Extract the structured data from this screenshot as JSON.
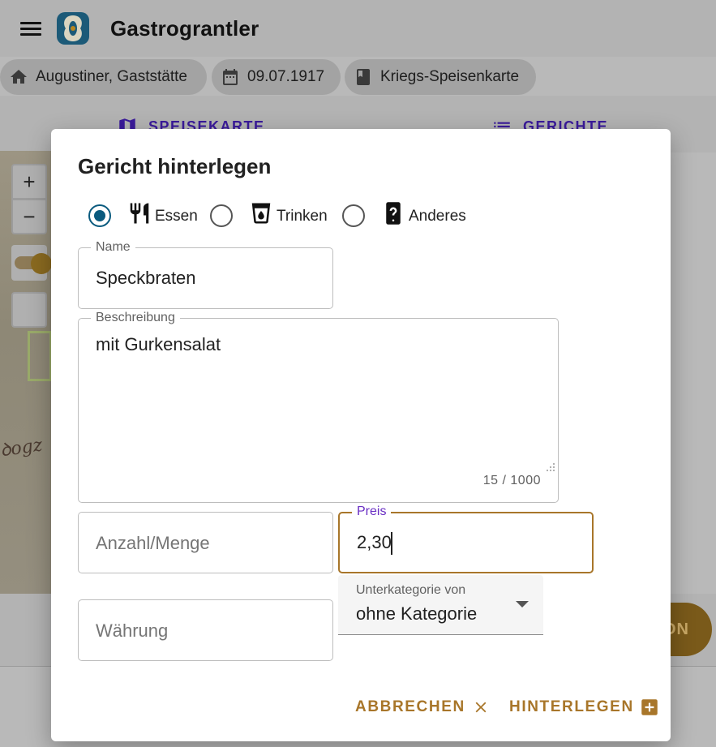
{
  "app": {
    "title": "Gastrograntler"
  },
  "chips": [
    {
      "label": "Augustiner, Gaststätte",
      "icon": "home-icon"
    },
    {
      "label": "09.07.1917",
      "icon": "calendar-icon"
    },
    {
      "label": "Kriegs-Speisenkarte",
      "icon": "book-icon"
    }
  ],
  "tabs": [
    {
      "label": "SPEISEKARTE",
      "icon": "map-icon"
    },
    {
      "label": "GERICHTE",
      "icon": "list-icon"
    }
  ],
  "map": {
    "zoom_in": "+",
    "zoom_out": "−"
  },
  "fab": {
    "label": "ON"
  },
  "dialog": {
    "title": "Gericht hinterlegen",
    "type_options": [
      {
        "label": "Essen",
        "icon": "cutlery-icon",
        "checked": true
      },
      {
        "label": "Trinken",
        "icon": "cup-icon",
        "checked": false
      },
      {
        "label": "Anderes",
        "icon": "unknown-device-icon",
        "checked": false
      }
    ],
    "name": {
      "label": "Name",
      "value": "Speckbraten"
    },
    "description": {
      "label": "Beschreibung",
      "value": "mit Gurkensalat",
      "counter": "15 / 1000"
    },
    "quantity": {
      "placeholder": "Anzahl/Menge"
    },
    "price": {
      "label": "Preis",
      "value": "2,30"
    },
    "currency": {
      "placeholder": "Währung"
    },
    "subcategory": {
      "label": "Unterkategorie von",
      "value": "ohne Kategorie"
    },
    "actions": {
      "cancel": "ABBRECHEN",
      "save": "HINTERLEGEN"
    }
  },
  "colors": {
    "accent": "#a8762a",
    "radio_checked": "#0a5a7e",
    "focus_label": "#6a2fc4",
    "tab_text": "#3a1a9a"
  }
}
